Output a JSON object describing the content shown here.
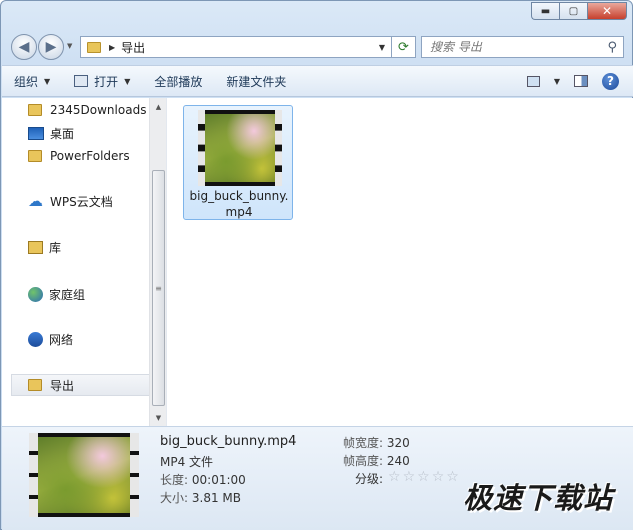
{
  "window": {
    "controls": {
      "minimize": "▬",
      "maximize": "▢",
      "close": "✕"
    }
  },
  "address": {
    "crumb": "导出",
    "search_placeholder": "搜索 导出"
  },
  "toolbar": {
    "organize": "组织",
    "open": "打开",
    "play_all": "全部播放",
    "new_folder": "新建文件夹"
  },
  "nav": {
    "items": [
      {
        "label": "2345Downloads",
        "icon": "folder-icon"
      },
      {
        "label": "桌面",
        "icon": "desktop-icon"
      },
      {
        "label": "PowerFolders",
        "icon": "folder-icon"
      },
      {
        "label": "WPS云文档",
        "icon": "cloud-icon"
      },
      {
        "label": "库",
        "icon": "library-icon"
      },
      {
        "label": "家庭组",
        "icon": "homegroup-icon"
      },
      {
        "label": "网络",
        "icon": "network-icon"
      },
      {
        "label": "导出",
        "icon": "folder-icon"
      }
    ]
  },
  "files": [
    {
      "name": "big_buck_bunny.mp4",
      "icon": "video-thumbnail"
    }
  ],
  "details": {
    "name": "big_buck_bunny.mp4",
    "type": "MP4 文件",
    "duration_label": "长度:",
    "duration": "00:01:00",
    "size_label": "大小:",
    "size": "3.81 MB",
    "width_label": "帧宽度:",
    "width": "320",
    "height_label": "帧高度:",
    "height": "240",
    "rating_label": "分级:",
    "rating": 0,
    "rating_max": 5
  },
  "watermark": "极速下载站",
  "colors": {
    "selection": "#cfe5fb",
    "selection_border": "#7eb4ea",
    "close_button": "#c7402d"
  }
}
